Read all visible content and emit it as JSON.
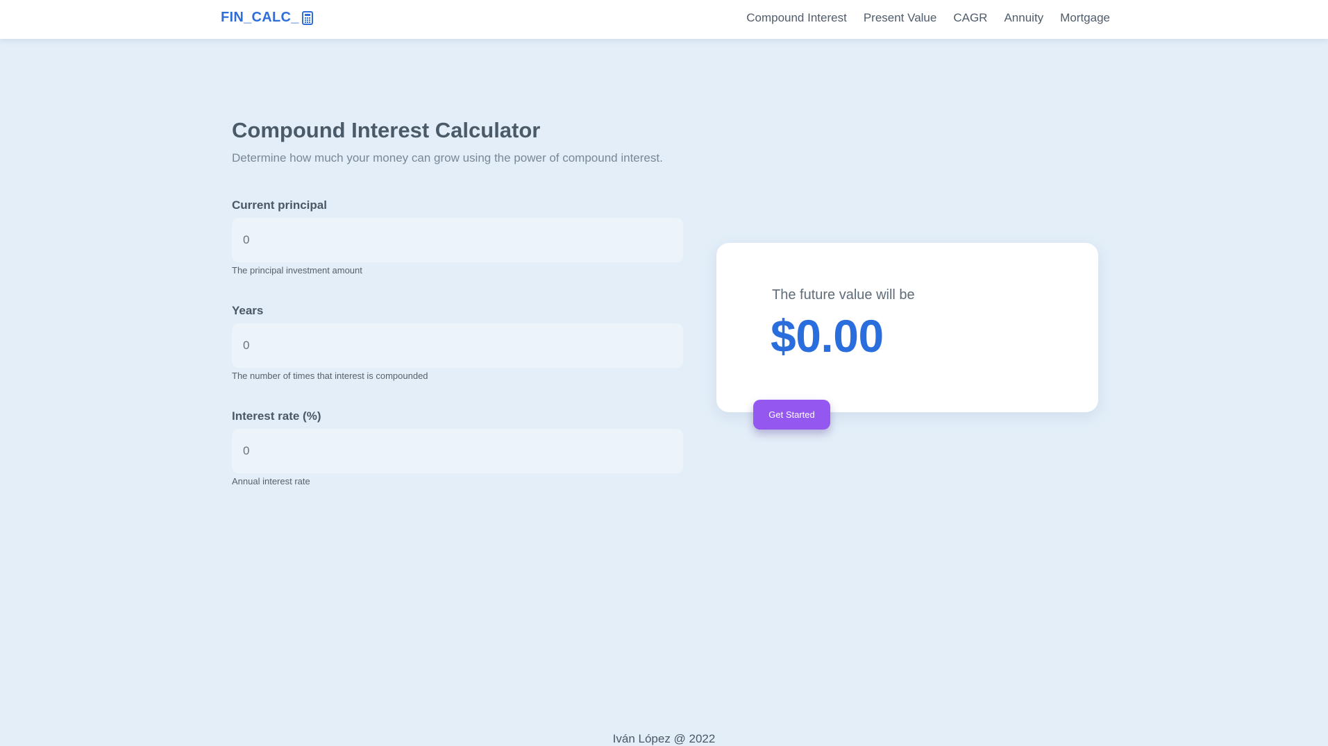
{
  "nav": {
    "brand": "FIN_CALC_",
    "brand_icon": "calculator-icon",
    "links": [
      "Compound Interest",
      "Present Value",
      "CAGR",
      "Annuity",
      "Mortgage"
    ]
  },
  "main": {
    "title": "Compound Interest Calculator",
    "subtitle": "Determine how much your money can grow using the power of compound interest.",
    "fields": [
      {
        "label": "Current principal",
        "value": "0",
        "help": "The principal investment amount"
      },
      {
        "label": "Years",
        "value": "0",
        "help": "The number of times that interest is compounded"
      },
      {
        "label": "Interest rate (%)",
        "value": "0",
        "help": "Annual interest rate"
      }
    ]
  },
  "result": {
    "caption": "The future value will be",
    "value": "$0.00",
    "button": "Get Started"
  },
  "footer": {
    "text": "Iván López @ 2022"
  },
  "colors": {
    "background": "#e3eef8",
    "brand": "#2f6ed8",
    "result_value": "#2a6ede",
    "button": "#9457f0",
    "input_bg": "#edf4f9"
  }
}
